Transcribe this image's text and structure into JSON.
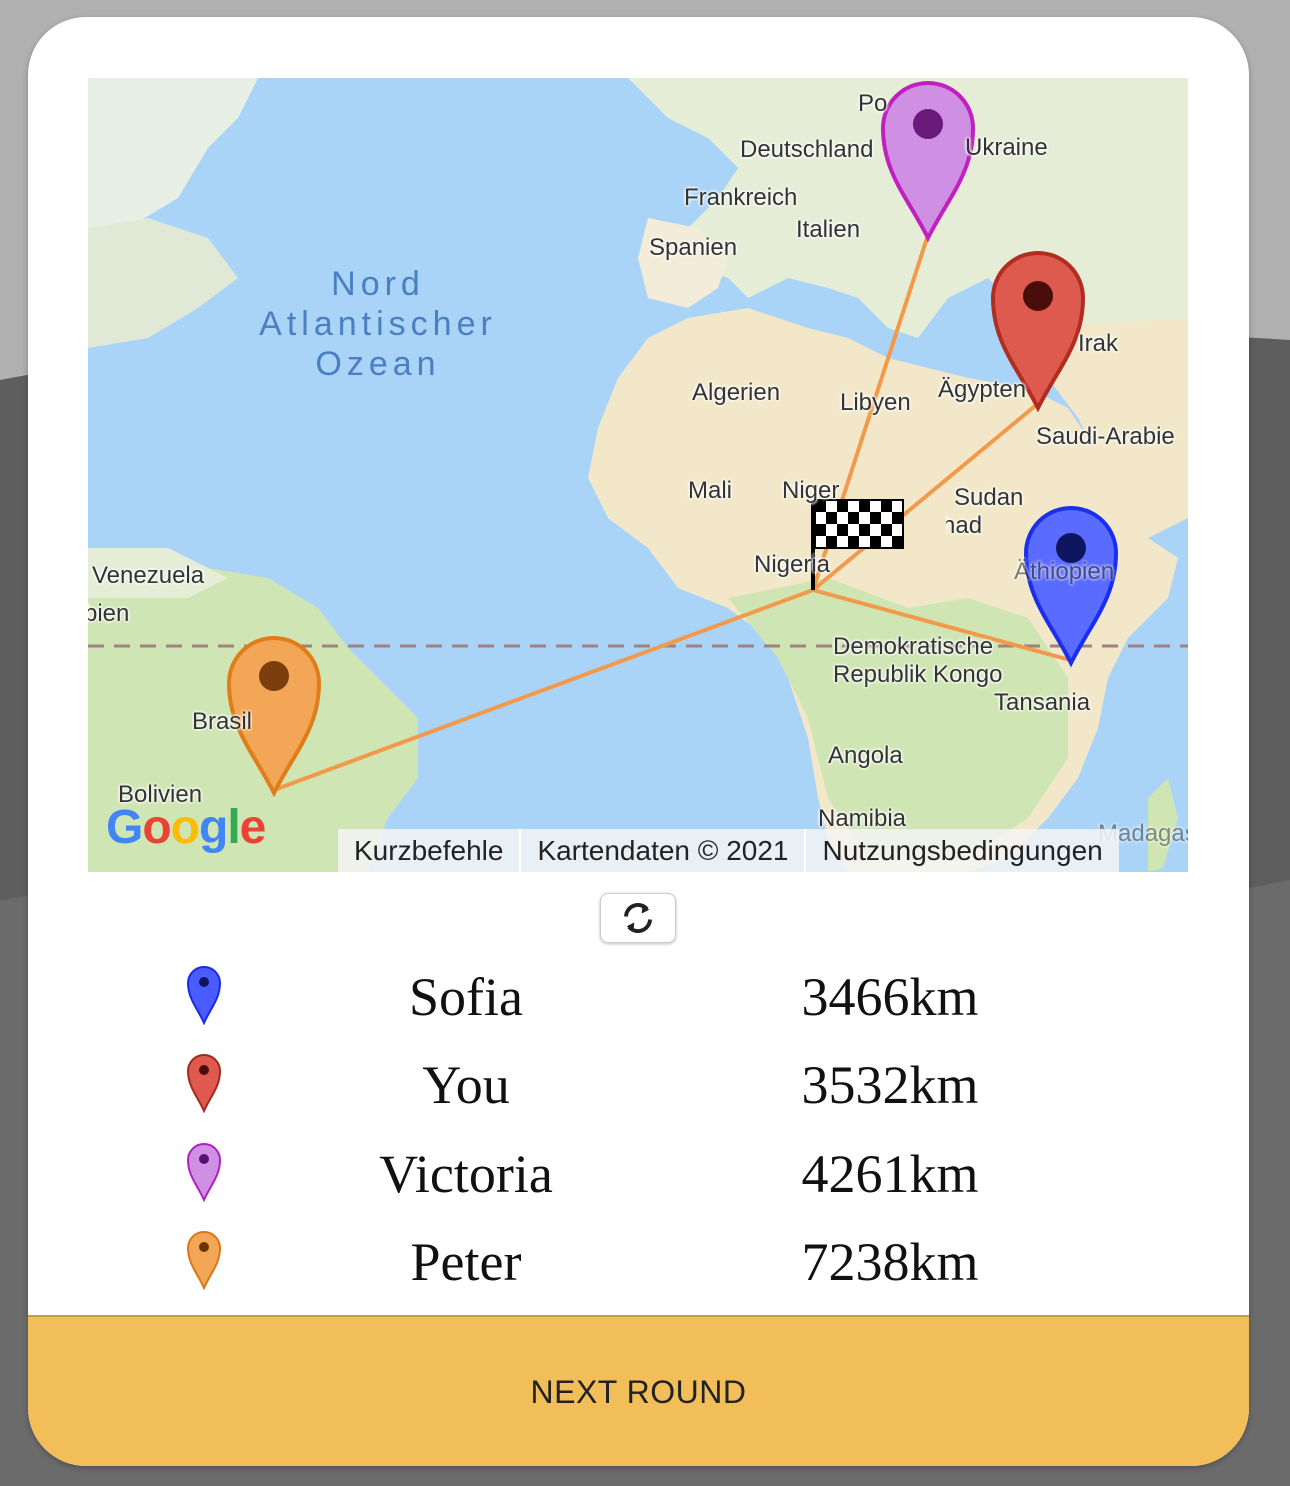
{
  "map": {
    "ocean_label": [
      "Nord",
      "Atlantischer",
      "Ozean"
    ],
    "labels": [
      {
        "text": "Deutschland",
        "name": "map-label-deutschland"
      },
      {
        "text": "Ukraine",
        "name": "map-label-ukraine"
      },
      {
        "text": "Po",
        "name": "map-label-polen"
      },
      {
        "text": "Frankreich",
        "name": "map-label-frankreich"
      },
      {
        "text": "Italien",
        "name": "map-label-italien"
      },
      {
        "text": "Spanien",
        "name": "map-label-spanien"
      },
      {
        "text": "Algerien",
        "name": "map-label-algerien"
      },
      {
        "text": "Libyen",
        "name": "map-label-libyen"
      },
      {
        "text": "Ägypten",
        "name": "map-label-aegypten"
      },
      {
        "text": "Irak",
        "name": "map-label-irak"
      },
      {
        "text": "Saudi-Arabie",
        "name": "map-label-saudi-arabien"
      },
      {
        "text": "Mali",
        "name": "map-label-mali"
      },
      {
        "text": "Niger",
        "name": "map-label-niger"
      },
      {
        "text": "Sudan",
        "name": "map-label-sudan"
      },
      {
        "text": "Tschad",
        "name": "map-label-tschad"
      },
      {
        "text": "Nigeria",
        "name": "map-label-nigeria"
      },
      {
        "text": "Äthiopien",
        "name": "map-label-aethiopien"
      },
      {
        "text": "Venezuela",
        "name": "map-label-venezuela"
      },
      {
        "text": "bien",
        "name": "map-label-kolumbien"
      },
      {
        "text": "Demokratische",
        "name": "map-label-drk-1"
      },
      {
        "text": "Republik Kongo",
        "name": "map-label-drk-2"
      },
      {
        "text": "Tansania",
        "name": "map-label-tansania"
      },
      {
        "text": "Brasilien",
        "name": "map-label-brasilien"
      },
      {
        "text": "Angola",
        "name": "map-label-angola"
      },
      {
        "text": "Bolivien",
        "name": "map-label-bolivien"
      },
      {
        "text": "Namibia",
        "name": "map-label-namibia"
      },
      {
        "text": "Madagaskar",
        "name": "map-label-madagaskar"
      }
    ],
    "google_logo": [
      "G",
      "o",
      "o",
      "g",
      "l",
      "e"
    ],
    "attribution": {
      "shortcuts": "Kurzbefehle",
      "data": "Kartendaten © 2021",
      "terms": "Nutzungsbedingungen"
    },
    "colors": {
      "ocean": "#aad3f8",
      "land": "#f5f0e1",
      "forest": "#c9e3b5",
      "desert": "#f2e8c9",
      "route_line": "#f2994a",
      "equator": "#a08080"
    }
  },
  "refresh_button": {
    "icon": "refresh-icon"
  },
  "results": [
    {
      "player": "Sofia",
      "distance": "3466km",
      "pin_color": "#4a5cff",
      "pin_dark": "#1b2a9e"
    },
    {
      "player": "You",
      "distance": "3532km",
      "pin_color": "#df5a4e",
      "pin_dark": "#8a1f16"
    },
    {
      "player": "Victoria",
      "distance": "4261km",
      "pin_color": "#cf8fe3",
      "pin_dark": "#7d2a99"
    },
    {
      "player": "Peter",
      "distance": "7238km",
      "pin_color": "#f2a656",
      "pin_dark": "#9a5a18"
    }
  ],
  "next_round_label": "NEXT ROUND"
}
